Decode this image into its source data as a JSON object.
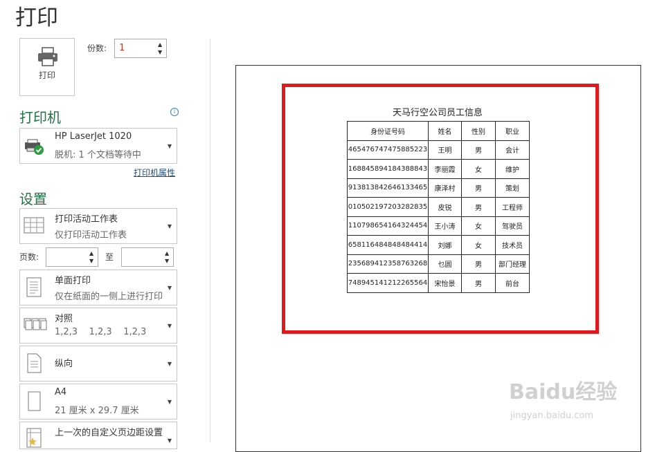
{
  "page_title": "打印",
  "print_button": {
    "label": "打印"
  },
  "copies": {
    "label": "份数:",
    "value": "1"
  },
  "printer": {
    "heading": "打印机",
    "name": "HP LaserJet 1020",
    "status": "脱机: 1 个文档等待中",
    "properties_link": "打印机属性"
  },
  "settings": {
    "heading": "设置",
    "scope": {
      "title": "打印活动工作表",
      "subtitle": "仅打印活动工作表"
    },
    "pages": {
      "label": "页数:",
      "to_label": "至",
      "from": "",
      "to": ""
    },
    "sides": {
      "title": "单面打印",
      "subtitle": "仅在纸面的一侧上进行打印"
    },
    "collate": {
      "title": "对照",
      "subtitle": "1,2,3    1,2,3    1,2,3"
    },
    "orientation": {
      "title": "纵向"
    },
    "paper": {
      "title": "A4",
      "subtitle": "21 厘米 x 29.7 厘米"
    },
    "margins": {
      "title": "上一次的自定义页边距设置"
    }
  },
  "preview": {
    "sheet_title": "天马行空公司员工信息",
    "headers": [
      "身份证号码",
      "姓名",
      "性别",
      "职业"
    ],
    "rows": [
      [
        "465476747475885223",
        "王明",
        "男",
        "会计"
      ],
      [
        "168845894184388843",
        "李丽霞",
        "女",
        "维护"
      ],
      [
        "913813842646133465",
        "康泽村",
        "男",
        "策划"
      ],
      [
        "010502197203282835",
        "皮锐",
        "男",
        "工程师"
      ],
      [
        "110798654164324454",
        "王小涛",
        "女",
        "驾驶员"
      ],
      [
        "658116484848484414",
        "刘娜",
        "女",
        "技术员"
      ],
      [
        "235689412358763268",
        "乜圆",
        "男",
        "部门经理"
      ],
      [
        "748945141212265564",
        "宋怡景",
        "男",
        "前台"
      ]
    ]
  },
  "watermark": {
    "brand": "Baidu经验",
    "url": "jingyan.baidu.com"
  },
  "colors": {
    "accent": "#217346",
    "red_frame": "#e0191c"
  }
}
